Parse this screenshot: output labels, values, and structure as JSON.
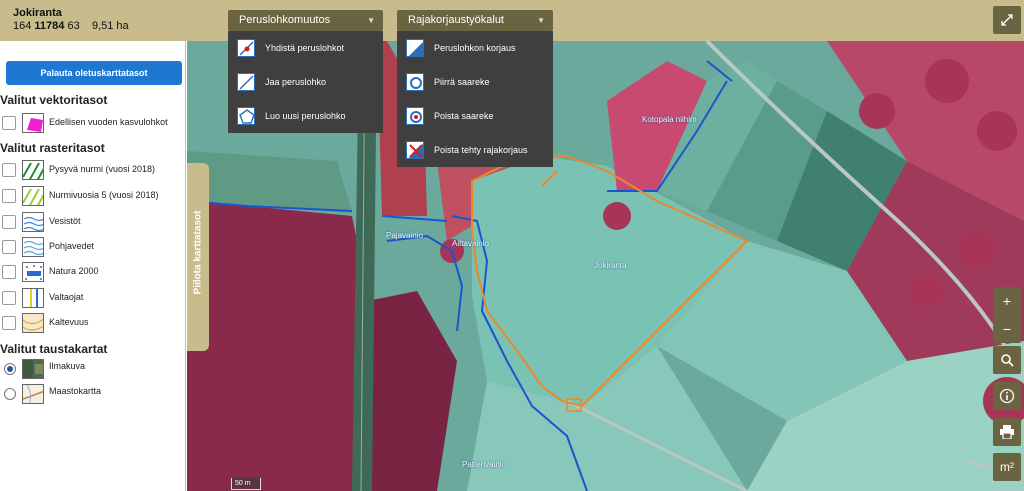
{
  "parcel": {
    "name": "Jokiranta",
    "id_prefix": "164",
    "id_main": "11784",
    "id_suffix": "63",
    "area": "9,51 ha"
  },
  "toolbar": {
    "peruslohko_label": "Peruslohkomuutos",
    "rajakorjaus_label": "Rajakorjaustyökalut"
  },
  "peruslohko_menu": [
    {
      "label": "Yhdistä peruslohkot",
      "icon": "merge-parcels-icon"
    },
    {
      "label": "Jaa peruslohko",
      "icon": "split-parcel-icon"
    },
    {
      "label": "Luo uusi peruslohko",
      "icon": "new-parcel-icon"
    }
  ],
  "rajakorjaus_menu": [
    {
      "label": "Peruslohkon korjaus",
      "icon": "fix-boundary-icon"
    },
    {
      "label": "Piirrä saareke",
      "icon": "draw-island-icon"
    },
    {
      "label": "Poista saareke",
      "icon": "remove-island-icon"
    },
    {
      "label": "Poista tehty rajakorjaus",
      "icon": "undo-fix-icon"
    }
  ],
  "sidebar": {
    "reset_label": "Palauta oletuskarttatasot",
    "vector_title": "Valitut vektoritasot",
    "vector_layers": [
      {
        "label": "Edellisen vuoden kasvulohkot"
      }
    ],
    "raster_title": "Valitut rasteritasot",
    "raster_layers": [
      {
        "label": "Pysyvä nurmi (vuosi 2018)"
      },
      {
        "label": "Nurmivuosia 5 (vuosi 2018)"
      },
      {
        "label": "Vesistöt"
      },
      {
        "label": "Pohjavedet"
      },
      {
        "label": "Natura 2000"
      },
      {
        "label": "Valtaojat"
      },
      {
        "label": "Kaltevuus"
      }
    ],
    "background_title": "Valitut taustakartat",
    "background_layers": [
      {
        "label": "Ilmakuva",
        "selected": true
      },
      {
        "label": "Maastokartta",
        "selected": false
      }
    ],
    "hide_label": "Piilota karttatasot"
  },
  "map": {
    "labels": [
      "Kotopala niihim",
      "Pajavainio",
      "Aittavainio",
      "Jokiranta",
      "Patterivainio"
    ],
    "scale": "50 m",
    "zoom_in": "+",
    "zoom_out": "−",
    "measure_area": "m²"
  },
  "colors": {
    "topbar": "#c9bc8c",
    "button_dark": "#6b6442",
    "menu_bg": "#3f3f3f",
    "accent_blue": "#1e78d2",
    "parcel_outline": "#e88a2a",
    "parcel_boundary": "#1a55d0"
  }
}
